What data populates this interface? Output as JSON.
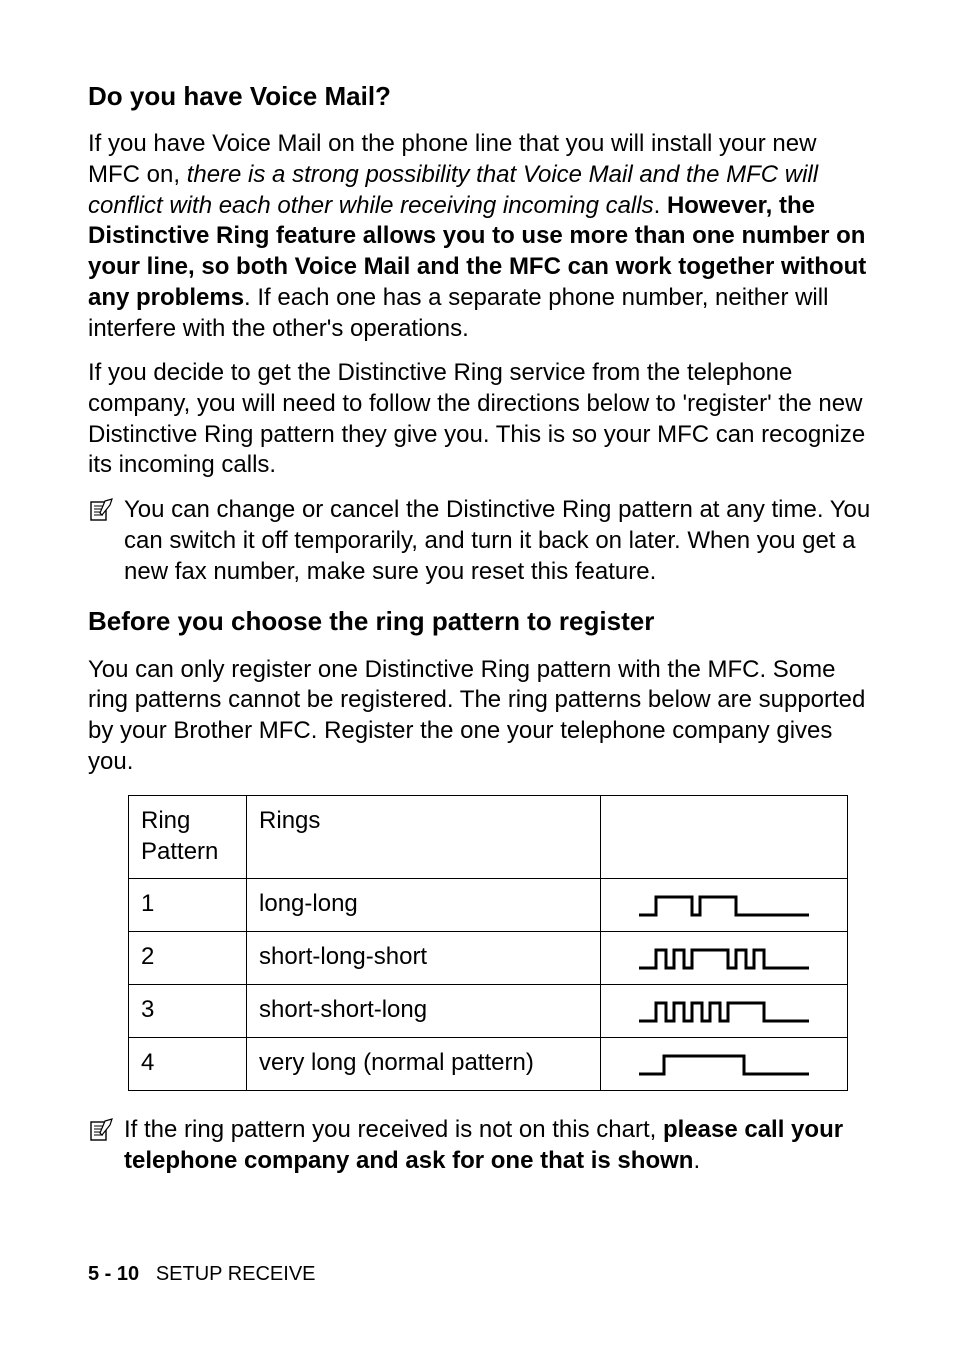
{
  "heading1": "Do you have Voice Mail?",
  "para1_part1": "If you have Voice Mail on the phone line that you will install your new MFC on, ",
  "para1_italic": "there is a strong possibility that Voice Mail and the MFC will conflict with each other while receiving incoming calls",
  "para1_part2": ". ",
  "para1_bold": "However, the Distinctive Ring feature allows you to use more than one number on your line, so both Voice Mail and the MFC can work together without any problems",
  "para1_part3": ". If each one has a separate phone number, neither will interfere with the other's operations.",
  "para2": "If you decide to get the Distinctive Ring service from the telephone company, you will need to follow the directions below to 'register' the new Distinctive Ring pattern they give you. This is so your MFC can recognize its incoming calls.",
  "note1": "You can change or cancel the Distinctive Ring pattern at any time. You can switch it off temporarily, and turn it back on later. When you get a new fax number, make sure you reset this feature.",
  "heading2": "Before you choose the ring pattern to register",
  "para3": "You can only register one Distinctive Ring pattern with the MFC. Some ring patterns cannot be registered. The ring patterns below are supported by your Brother MFC. Register the one your telephone company gives you.",
  "table": {
    "header_col1": "Ring Pattern",
    "header_col2": "Rings",
    "rows": [
      {
        "num": "1",
        "desc": "long-long"
      },
      {
        "num": "2",
        "desc": "short-long-short"
      },
      {
        "num": "3",
        "desc": "short-short-long"
      },
      {
        "num": "4",
        "desc": "very long (normal pattern)"
      }
    ]
  },
  "note2_part1": "If the ring pattern you received is not on this chart, ",
  "note2_bold": "please call your telephone company and ask for one that is shown",
  "note2_part2": ".",
  "footer_page": "5 - 10",
  "footer_section": "SETUP RECEIVE"
}
